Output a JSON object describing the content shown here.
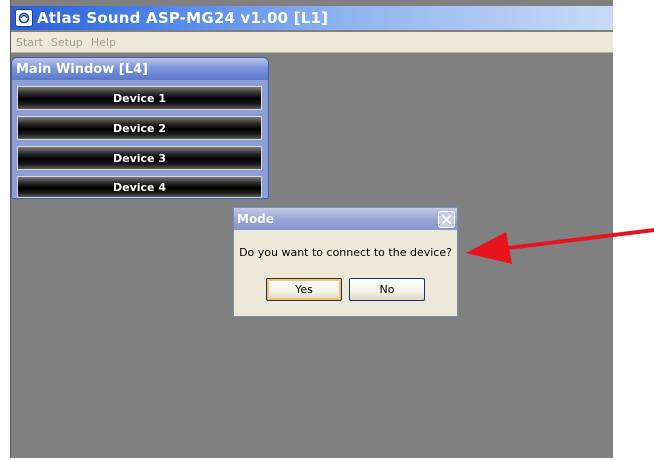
{
  "app": {
    "title": "Atlas Sound   ASP-MG24 v1.00   [L1]",
    "icon": "app-logo-icon"
  },
  "menu": {
    "items": [
      "Start",
      "Setup",
      "Help"
    ]
  },
  "main_window": {
    "title": "Main Window [L4]",
    "devices": [
      "Device 1",
      "Device 2",
      "Device 3",
      "Device 4"
    ]
  },
  "dialog": {
    "title": "Mode",
    "message": "Do you want to connect to the device?",
    "yes_label": "Yes",
    "no_label": "No",
    "close_icon": "close-icon"
  },
  "annotation": {
    "arrow_color": "#e8141c",
    "icon": "red-arrow-icon"
  },
  "colors": {
    "workspace": "#808080",
    "titlebar_accent": "#2a5fd6",
    "arrow": "#e8141c"
  }
}
